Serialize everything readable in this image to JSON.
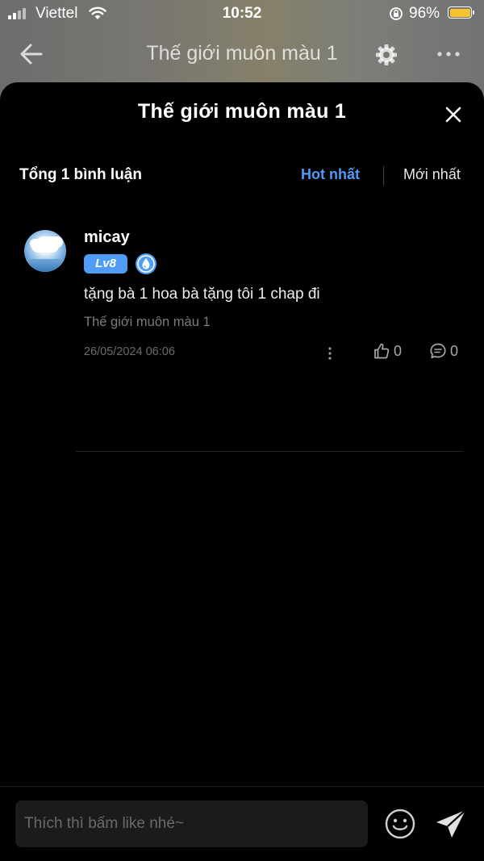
{
  "status_bar": {
    "carrier": "Viettel",
    "time": "10:52",
    "battery_percent": "96%",
    "battery_color": "#f7c331"
  },
  "reader_header": {
    "title": "Thế giới muôn màu 1",
    "icons": [
      "back-arrow-icon",
      "gear-icon",
      "more-icon"
    ]
  },
  "sheet": {
    "title": "Thế giới muôn màu 1",
    "summary": "Tổng 1 bình luận",
    "sort": {
      "hot_label": "Hot nhất",
      "new_label": "Mới nhất",
      "active": "hot",
      "active_color": "#4f9bf6"
    }
  },
  "comments": [
    {
      "username": "micay",
      "level": "Lv8",
      "text": "tặng bà 1 hoa bà tặng tôi 1 chap đi",
      "chapter": "Thế giới muôn màu 1",
      "timestamp": "26/05/2024 06:06",
      "likes": "0",
      "replies": "0"
    }
  ],
  "composer": {
    "placeholder": "Thích thì bấm like nhé~",
    "value": ""
  }
}
